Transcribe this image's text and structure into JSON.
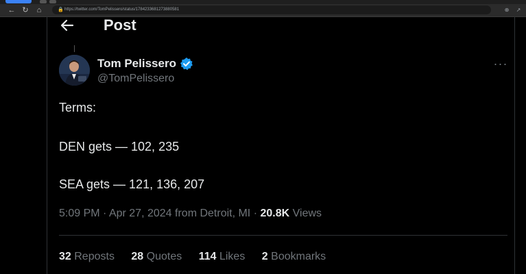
{
  "browser": {
    "url": "https://twitter.com/TomPelissero/status/1784233681273880581"
  },
  "header": {
    "title": "Post"
  },
  "tweet": {
    "author_name": "Tom Pelissero",
    "handle": "@TomPelissero",
    "lines": [
      "Terms:",
      "DEN gets — 102, 235",
      "SEA gets — 121, 136, 207"
    ],
    "time": "5:09 PM",
    "date": "Apr 27, 2024",
    "location": "from Detroit, MI",
    "views_count": "20.8K",
    "views_label": "Views"
  },
  "stats": {
    "reposts_count": "32",
    "reposts_label": "Reposts",
    "quotes_count": "28",
    "quotes_label": "Quotes",
    "likes_count": "114",
    "likes_label": "Likes",
    "bookmarks_count": "2",
    "bookmarks_label": "Bookmarks"
  },
  "colors": {
    "background": "#000000",
    "primary_text": "#e7e9ea",
    "secondary_text": "#71767b",
    "verified_blue": "#1d9bf0",
    "border": "#2f3336"
  }
}
